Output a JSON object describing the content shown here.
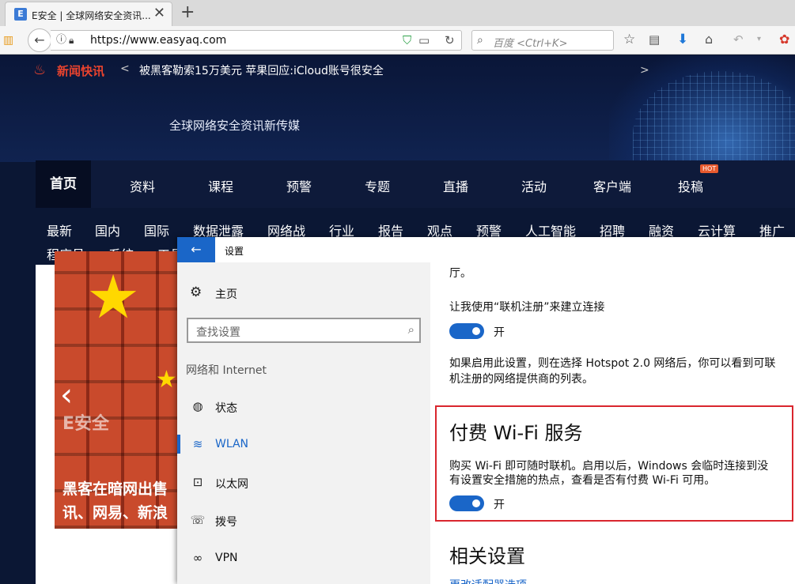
{
  "browser": {
    "tab": {
      "favicon": "E",
      "title": "E安全 | 全球网络安全资讯..."
    },
    "url": "https://www.easyaq.com",
    "search_placeholder": "百度 <Ctrl+K>"
  },
  "site": {
    "news_label": "新闻快讯",
    "news_prev": "<",
    "news_headline": "被黑客勒索15万美元 苹果回应:iCloud账号很安全",
    "news_next": ">",
    "tagline": "全球网络安全资讯新传媒",
    "main_nav": [
      "首页",
      "资料",
      "课程",
      "预警",
      "专题",
      "直播",
      "活动",
      "客户端",
      "投稿"
    ],
    "hot_badge": "HOT",
    "sub_nav_row1": [
      "最新",
      "国内",
      "国际",
      "数据泄露",
      "网络战",
      "行业",
      "报告",
      "观点",
      "预警",
      "人工智能",
      "招聘",
      "融资",
      "云计算",
      "推广"
    ],
    "sub_nav_row2": [
      "程序员",
      "系统",
      "工具"
    ],
    "slide": {
      "watermark": "E安全",
      "headline_line1": "黑客在暗网出售",
      "headline_line2": "讯、网易、新浪"
    }
  },
  "settings": {
    "title": "设置",
    "home_label": "主页",
    "search_placeholder": "查找设置",
    "section": "网络和 Internet",
    "nav_items": [
      {
        "label": "状态",
        "icon": "globe-icon"
      },
      {
        "label": "WLAN",
        "icon": "wifi-icon"
      },
      {
        "label": "以太网",
        "icon": "ethernet-icon"
      },
      {
        "label": "拨号",
        "icon": "dialup-icon"
      },
      {
        "label": "VPN",
        "icon": "vpn-icon"
      }
    ],
    "body": {
      "cut_line": "厅。",
      "online_signup_label": "让我使用“联机注册”来建立连接",
      "toggle_on": "开",
      "hotspot_line1": "如果启用此设置，则在选择 Hotspot 2.0 网络后，你可以看到可联",
      "hotspot_line2": "机注册的网络提供商的列表。",
      "paid_wifi_heading": "付费 Wi-Fi 服务",
      "paid_line1": "购买 Wi-Fi 即可随时联机。启用以后，Windows 会临时连接到没",
      "paid_line2": "有设置安全措施的热点，查看是否有付费 Wi-Fi 可用。",
      "related_heading": "相关设置",
      "related_link": "更改适配器选项"
    }
  }
}
